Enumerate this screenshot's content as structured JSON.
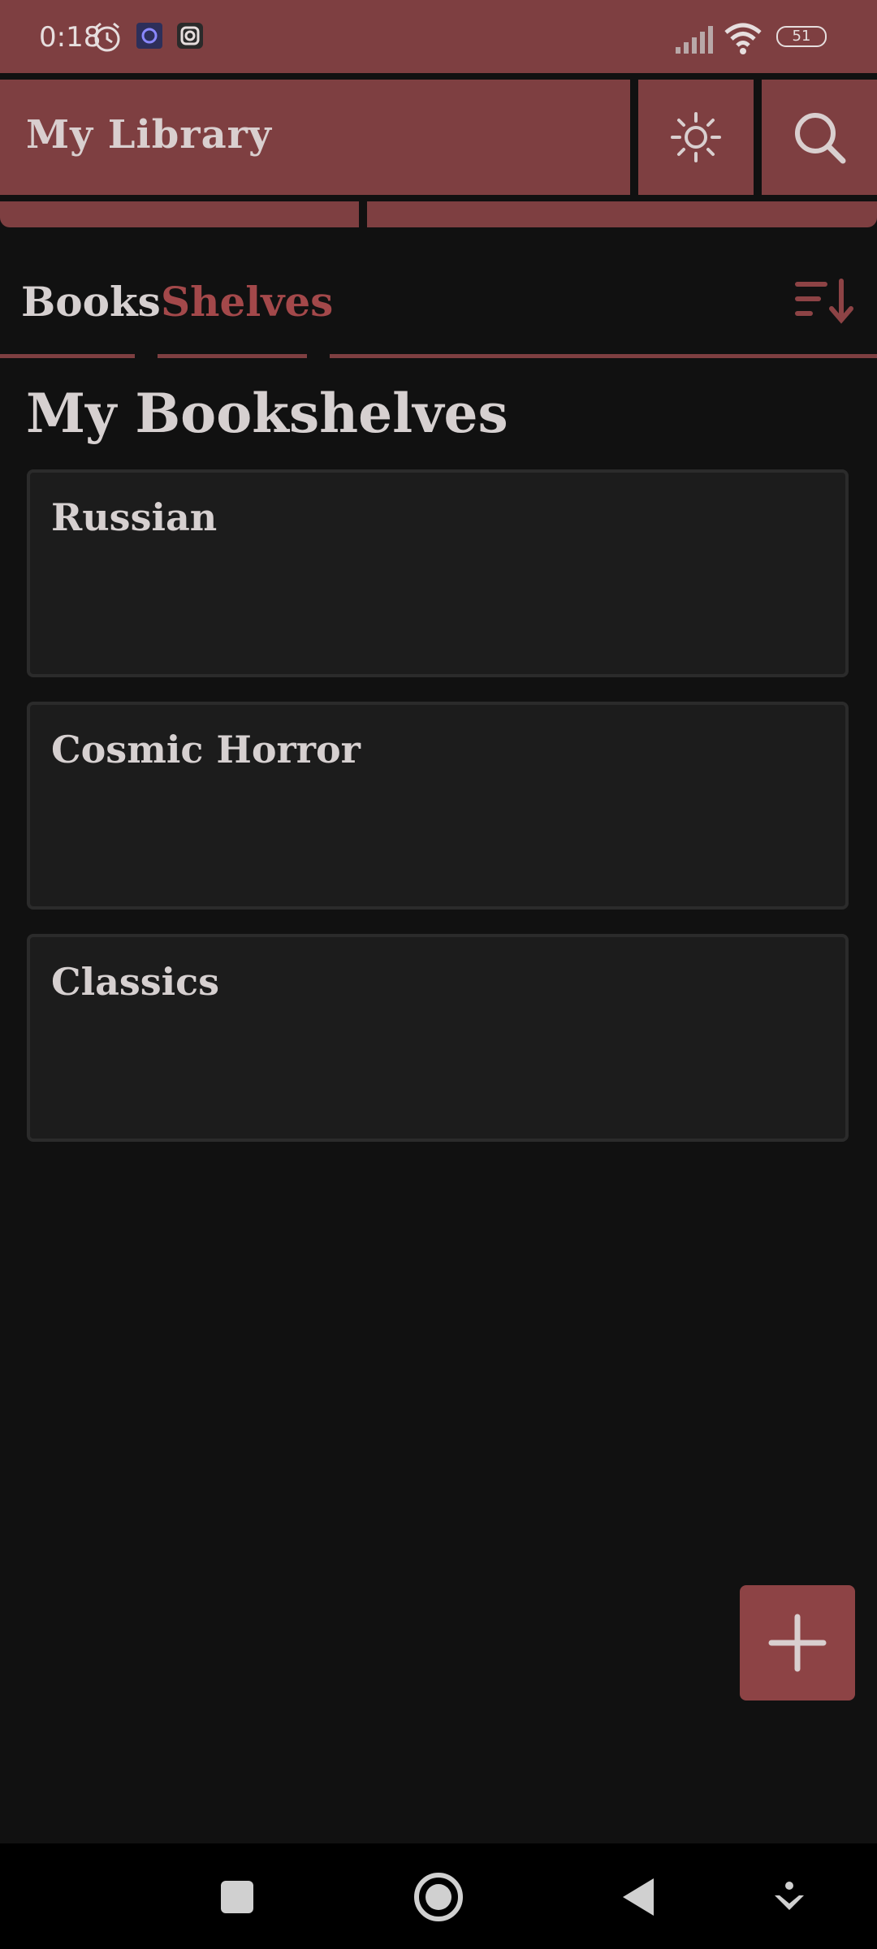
{
  "status_bar": {
    "time": "0:18",
    "battery": "51"
  },
  "app_bar": {
    "title": "My Library",
    "theme_icon": "sun-icon",
    "search_icon": "search-icon"
  },
  "tabs": [
    {
      "label": "Books",
      "active": false
    },
    {
      "label": "Shelves",
      "active": true
    }
  ],
  "page_title": "My Bookshelves",
  "shelves": [
    {
      "name": "Russian"
    },
    {
      "name": "Cosmic Horror"
    },
    {
      "name": "Classics"
    }
  ],
  "colors": {
    "accent": "#7e3f41",
    "active_tab": "#a3484a",
    "background": "#111111",
    "card": "#1c1c1c"
  }
}
